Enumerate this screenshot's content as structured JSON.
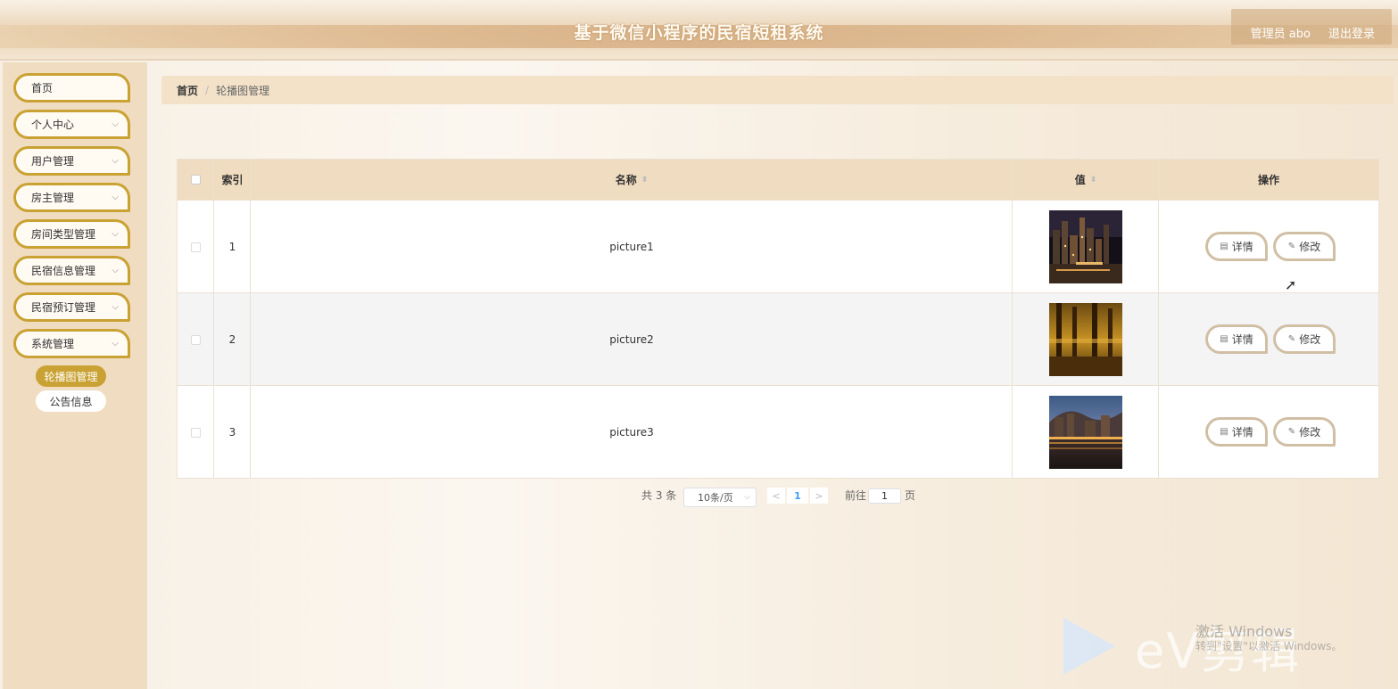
{
  "header": {
    "title": "基于微信小程序的民宿短租系统",
    "user_label": "管理员 abo",
    "logout_label": "退出登录"
  },
  "sidebar": {
    "items": [
      {
        "label": "首页",
        "has_chevron": false
      },
      {
        "label": "个人中心",
        "has_chevron": true
      },
      {
        "label": "用户管理",
        "has_chevron": true
      },
      {
        "label": "房主管理",
        "has_chevron": true
      },
      {
        "label": "房间类型管理",
        "has_chevron": true
      },
      {
        "label": "民宿信息管理",
        "has_chevron": true
      },
      {
        "label": "民宿预订管理",
        "has_chevron": true
      },
      {
        "label": "系统管理",
        "has_chevron": true
      }
    ],
    "sub_items": [
      {
        "label": "轮播图管理",
        "active": true
      },
      {
        "label": "公告信息",
        "active": false
      }
    ]
  },
  "breadcrumb": {
    "home": "首页",
    "separator": "/",
    "current": "轮播图管理"
  },
  "table": {
    "columns": {
      "index": "索引",
      "name": "名称",
      "value": "值",
      "actions": "操作"
    },
    "rows": [
      {
        "index": "1",
        "name": "picture1",
        "image": "city-night-skyline"
      },
      {
        "index": "2",
        "name": "picture2",
        "image": "golden-pier-sunset"
      },
      {
        "index": "3",
        "name": "picture3",
        "image": "city-dusk-reflection"
      }
    ],
    "detail_label": "详情",
    "edit_label": "修改"
  },
  "pagination": {
    "total": "共 3 条",
    "page_size": "10条/页",
    "prev": "<",
    "current_page": "1",
    "next": ">",
    "goto_label": "前往",
    "goto_value": "1",
    "page_suffix": "页"
  },
  "watermark": {
    "line1": "激活 Windows",
    "line2": "转到\"设置\"以激活 Windows。",
    "logo_text": "eV剪辑"
  },
  "colors": {
    "accent": "#c9a233",
    "sidebar_bg": "#f0dcc0",
    "header_band": "#d6ad82"
  }
}
